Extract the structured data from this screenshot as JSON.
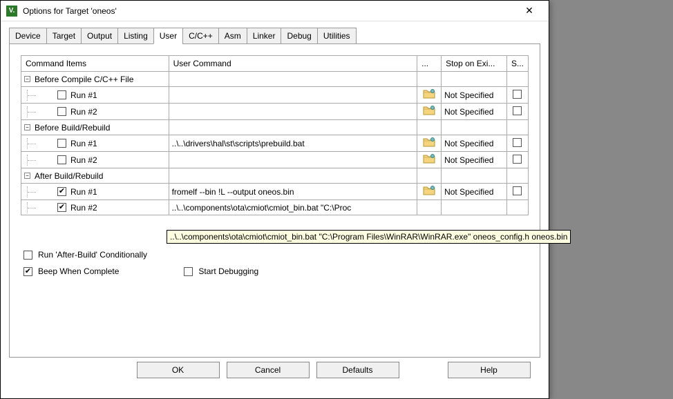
{
  "window": {
    "title": "Options for Target 'oneos'"
  },
  "tabs": [
    "Device",
    "Target",
    "Output",
    "Listing",
    "User",
    "C/C++",
    "Asm",
    "Linker",
    "Debug",
    "Utilities"
  ],
  "activeTab": 4,
  "grid": {
    "headers": {
      "command_items": "Command Items",
      "user_command": "User Command",
      "dots": "...",
      "stop": "Stop on Exi...",
      "s": "S..."
    },
    "groups": [
      {
        "label": "Before Compile C/C++ File",
        "rows": [
          {
            "label": "Run #1",
            "checked": false,
            "cmd": "",
            "hasFolder": true,
            "stop": "Not Specified",
            "s": false
          },
          {
            "label": "Run #2",
            "checked": false,
            "cmd": "",
            "hasFolder": true,
            "stop": "Not Specified",
            "s": false
          }
        ]
      },
      {
        "label": "Before Build/Rebuild",
        "rows": [
          {
            "label": "Run #1",
            "checked": false,
            "cmd": "..\\..\\drivers\\hal\\st\\scripts\\prebuild.bat",
            "hasFolder": true,
            "stop": "Not Specified",
            "s": false
          },
          {
            "label": "Run #2",
            "checked": false,
            "cmd": "",
            "hasFolder": true,
            "stop": "Not Specified",
            "s": false
          }
        ]
      },
      {
        "label": "After Build/Rebuild",
        "rows": [
          {
            "label": "Run #1",
            "checked": true,
            "cmd": "fromelf --bin !L --output oneos.bin",
            "hasFolder": true,
            "stop": "Not Specified",
            "s": false
          },
          {
            "label": "Run #2",
            "checked": true,
            "cmd": "..\\..\\components\\ota\\cmiot\\cmiot_bin.bat \"C:\\Proc",
            "hasFolder": false,
            "stop": "",
            "s": false
          }
        ]
      }
    ]
  },
  "options": {
    "run_after_build": {
      "label": "Run 'After-Build' Conditionally",
      "checked": false
    },
    "beep": {
      "label": "Beep When Complete",
      "checked": true
    },
    "start_debug": {
      "label": "Start Debugging",
      "checked": false
    }
  },
  "buttons": {
    "ok": "OK",
    "cancel": "Cancel",
    "defaults": "Defaults",
    "help": "Help"
  },
  "tooltip": "..\\..\\components\\ota\\cmiot\\cmiot_bin.bat \"C:\\Program Files\\WinRAR\\WinRAR.exe\" oneos_config.h oneos.bin"
}
